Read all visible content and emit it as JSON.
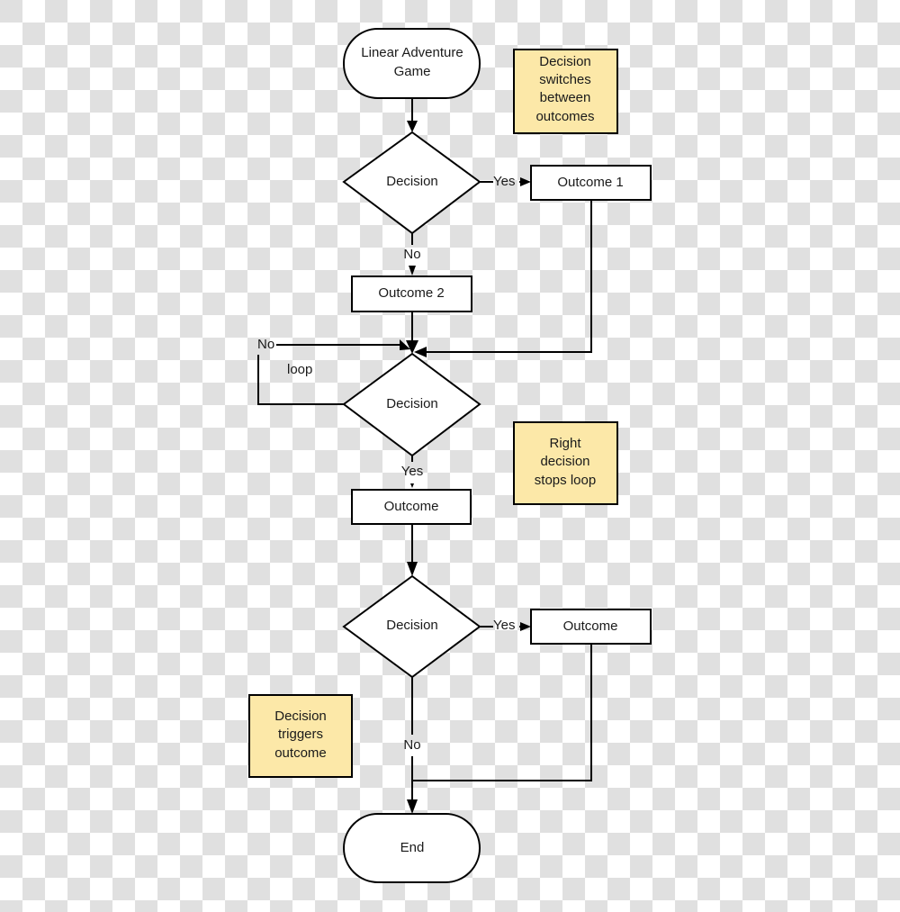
{
  "diagram": {
    "type": "flowchart",
    "colors": {
      "note_fill": "#fce8a8",
      "stroke": "#000000",
      "shape_fill": "#ffffff"
    },
    "nodes": {
      "start": {
        "kind": "terminator",
        "lines": [
          "Linear Adventure",
          "Game"
        ]
      },
      "decision1": {
        "kind": "decision",
        "label": "Decision"
      },
      "outcome1": {
        "kind": "process",
        "label": "Outcome 1"
      },
      "outcome2": {
        "kind": "process",
        "label": "Outcome 2"
      },
      "decision2": {
        "kind": "decision",
        "label": "Decision"
      },
      "outcome3": {
        "kind": "process",
        "label": "Outcome"
      },
      "decision3": {
        "kind": "decision",
        "label": "Decision"
      },
      "outcome4": {
        "kind": "process",
        "label": "Outcome"
      },
      "end": {
        "kind": "terminator",
        "lines": [
          "End"
        ]
      }
    },
    "notes": {
      "note1": {
        "lines": [
          "Decision",
          "switches",
          "between",
          "outcomes"
        ]
      },
      "note2": {
        "lines": [
          "Right",
          "decision",
          "stops loop"
        ]
      },
      "note3": {
        "lines": [
          "Decision",
          "triggers",
          "outcome"
        ]
      }
    },
    "edge_labels": {
      "d1_yes": "Yes",
      "d1_no": "No",
      "d2_no": "No",
      "d2_loop": "loop",
      "d2_yes": "Yes",
      "d3_yes": "Yes",
      "d3_no": "No"
    },
    "edges": [
      {
        "from": "start",
        "to": "decision1"
      },
      {
        "from": "decision1",
        "to": "outcome1",
        "label": "Yes"
      },
      {
        "from": "decision1",
        "to": "outcome2",
        "label": "No"
      },
      {
        "from": "outcome2",
        "to": "decision2"
      },
      {
        "from": "outcome1",
        "to": "decision2"
      },
      {
        "from": "decision2",
        "to": "decision2",
        "label": "No"
      },
      {
        "from": "decision2",
        "to": "outcome3",
        "label": "Yes"
      },
      {
        "from": "outcome3",
        "to": "decision3"
      },
      {
        "from": "decision3",
        "to": "outcome4",
        "label": "Yes"
      },
      {
        "from": "decision3",
        "to": "end",
        "label": "No"
      },
      {
        "from": "outcome4",
        "to": "end"
      }
    ]
  }
}
